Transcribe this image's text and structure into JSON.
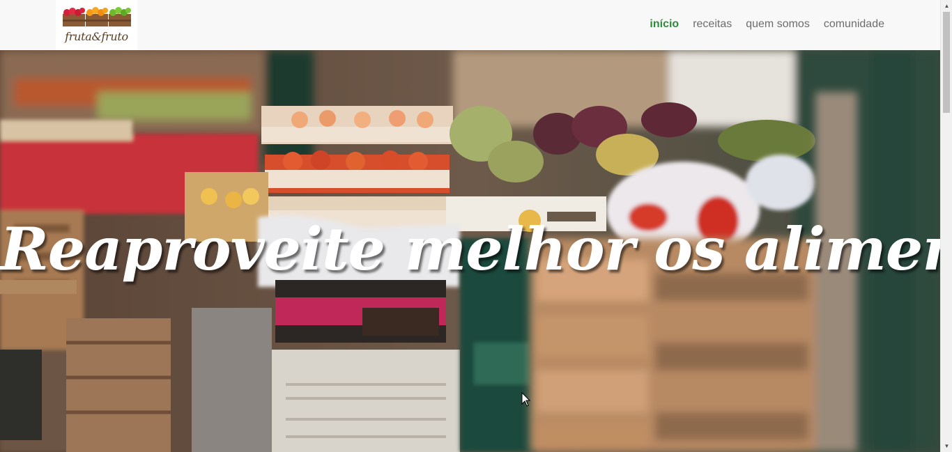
{
  "brand": {
    "name": "fruta&fruto",
    "logo_icon": "fruit-crates-icon"
  },
  "nav": {
    "items": [
      {
        "label": "início",
        "active": true
      },
      {
        "label": "receitas",
        "active": false
      },
      {
        "label": "quem somos",
        "active": false
      },
      {
        "label": "comunidade",
        "active": false
      }
    ]
  },
  "hero": {
    "title": "Reaproveite melhor os alimentos!",
    "background": "market-stall-fruit-crates-photo"
  },
  "colors": {
    "accent": "#2e8b3a",
    "nav_text": "#6c6c6c",
    "navbar_bg": "#f8f8f8"
  },
  "scrollbar": {
    "up_icon": "scroll-up-arrow-icon",
    "down_icon": "scroll-down-arrow-icon"
  }
}
